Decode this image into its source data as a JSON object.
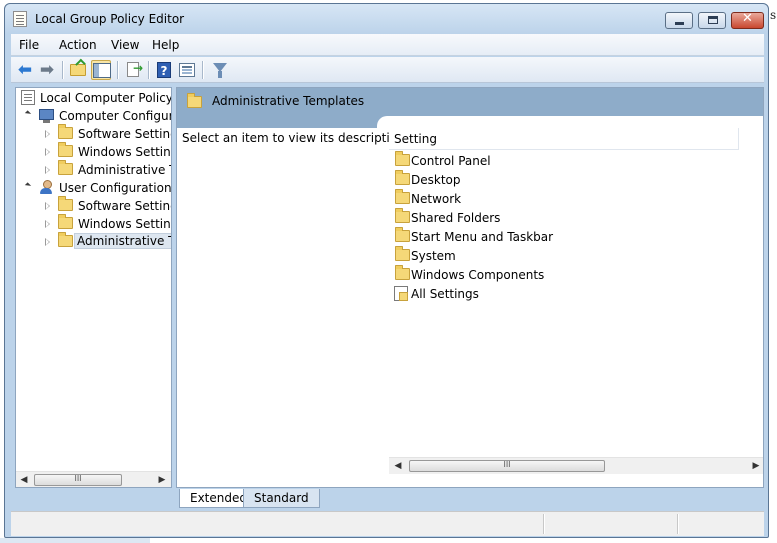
{
  "window": {
    "title": "Local Group Policy Editor",
    "close_glyph": "✕",
    "edge_text": "s"
  },
  "menu": [
    "File",
    "Action",
    "View",
    "Help"
  ],
  "toolbar": {
    "back": "back-arrow-icon",
    "forward": "forward-arrow-icon",
    "up": "up-folder-icon",
    "show_hide_tree": "show-hide-tree-icon",
    "export": "export-list-icon",
    "help": "?",
    "properties": "properties-icon",
    "filter": "filter-icon"
  },
  "tree": {
    "items": [
      {
        "label": "Local Computer Policy",
        "icon": "document-icon",
        "level": 0
      },
      {
        "label": "Computer Configura",
        "icon": "computer-icon",
        "level": 1,
        "expanded": true
      },
      {
        "label": "Software Settings",
        "icon": "folder-icon",
        "level": 2
      },
      {
        "label": "Windows Setting",
        "icon": "folder-icon",
        "level": 2
      },
      {
        "label": "Administrative Te",
        "icon": "folder-icon",
        "level": 2
      },
      {
        "label": "User Configuration",
        "icon": "user-icon",
        "level": 1,
        "expanded": true
      },
      {
        "label": "Software Settings",
        "icon": "folder-icon",
        "level": 2
      },
      {
        "label": "Windows Setting",
        "icon": "folder-icon",
        "level": 2
      },
      {
        "label": "Administrative Te",
        "icon": "folder-icon",
        "level": 2,
        "selected": true
      }
    ],
    "scroll_grip": "III"
  },
  "right_pane": {
    "header_title": "Administrative Templates",
    "description": "Select an item to view its description.",
    "column_header": "Setting",
    "items": [
      {
        "label": "Control Panel",
        "icon": "folder-icon"
      },
      {
        "label": "Desktop",
        "icon": "folder-icon"
      },
      {
        "label": "Network",
        "icon": "folder-icon"
      },
      {
        "label": "Shared Folders",
        "icon": "folder-icon"
      },
      {
        "label": "Start Menu and Taskbar",
        "icon": "folder-icon"
      },
      {
        "label": "System",
        "icon": "folder-icon"
      },
      {
        "label": "Windows Components",
        "icon": "folder-icon"
      },
      {
        "label": "All Settings",
        "icon": "all-settings-icon"
      }
    ],
    "scroll_grip": "III"
  },
  "tabs": [
    {
      "label": "Extended",
      "active": true
    },
    {
      "label": "Standard",
      "active": false
    }
  ],
  "scroll_arrows": {
    "left": "◀",
    "right": "▶"
  },
  "status": [
    "",
    "",
    ""
  ],
  "colors": {
    "window_frame": "#bcd3ea",
    "pane_header": "#8eacc9",
    "close_button": "#c9472f",
    "folder": "#f5d878"
  }
}
